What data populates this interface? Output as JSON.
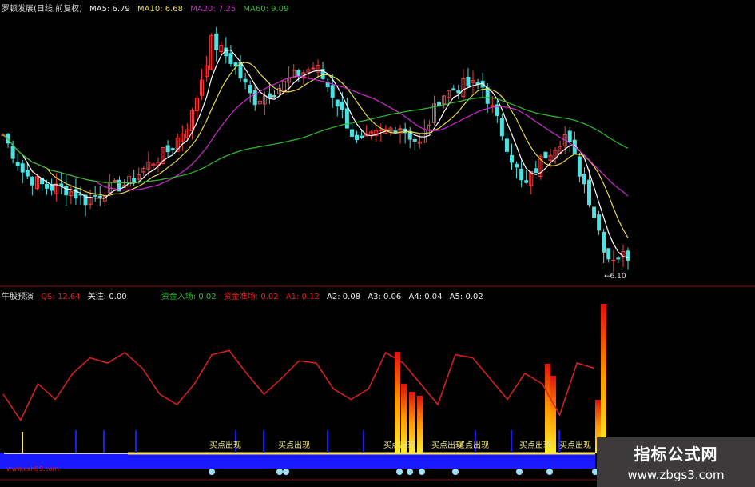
{
  "header": {
    "title": "罗顿发展(日线,前复权)",
    "ma5": "MA5: 6.79",
    "ma10": "MA10: 6.68",
    "ma20": "MA20: 7.25",
    "ma60": "MA60: 9.09"
  },
  "indicator_header": {
    "name": "牛股预演",
    "qs": "QS: 12.64",
    "guanzhu": "关注: 0.00",
    "zijin_ruchang": "资金入场: 0.02",
    "zijin_zhunchang": "资金准场: 0.02",
    "a1": "A1: 0.12",
    "a2": "A2: 0.08",
    "a3": "A3: 0.06",
    "a4": "A4: 0.04",
    "a5": "A5: 0.02"
  },
  "signal_label": "买点出现",
  "low_marker": "←6.10",
  "site_text": "www.cxh99.com",
  "watermark": {
    "name": "指标公式网",
    "url": "www.zbgs3.com"
  },
  "colors": {
    "up": "#ff3b3b",
    "down": "#4fe0e0",
    "ma5": "#ffffff",
    "ma10": "#e8d84a",
    "ma20": "#d02ad0",
    "ma60": "#2fbf2f",
    "osc": "#e02020",
    "bar": "#1a1aff"
  },
  "chart_data": [
    {
      "type": "candlestick",
      "title": "罗顿发展(日线,前复权)",
      "close_path": [
        9.53,
        8.55,
        8.23,
        8.18,
        7.89,
        8.18,
        8.31,
        8.8,
        9.16,
        9.9,
        11.86,
        11.37,
        10.39,
        10.63,
        11.0,
        11.25,
        10.39,
        9.29,
        9.53,
        9.78,
        9.29,
        10.51,
        10.76,
        10.76,
        9.53,
        8.18,
        9.04,
        9.53,
        8.18,
        6.47,
        6.52
      ],
      "ylim": [
        5.8,
        12.5
      ],
      "annotations": [
        "←6.10"
      ]
    },
    {
      "type": "line",
      "title": "牛股预演",
      "values": [
        40,
        15,
        50,
        35,
        60,
        75,
        70,
        80,
        65,
        40,
        30,
        50,
        78,
        82,
        60,
        40,
        55,
        72,
        70,
        45,
        35,
        45,
        80,
        70,
        50,
        30,
        78,
        75,
        55,
        35,
        60,
        50,
        20,
        70,
        65
      ],
      "ylim": [
        0,
        100
      ]
    }
  ]
}
